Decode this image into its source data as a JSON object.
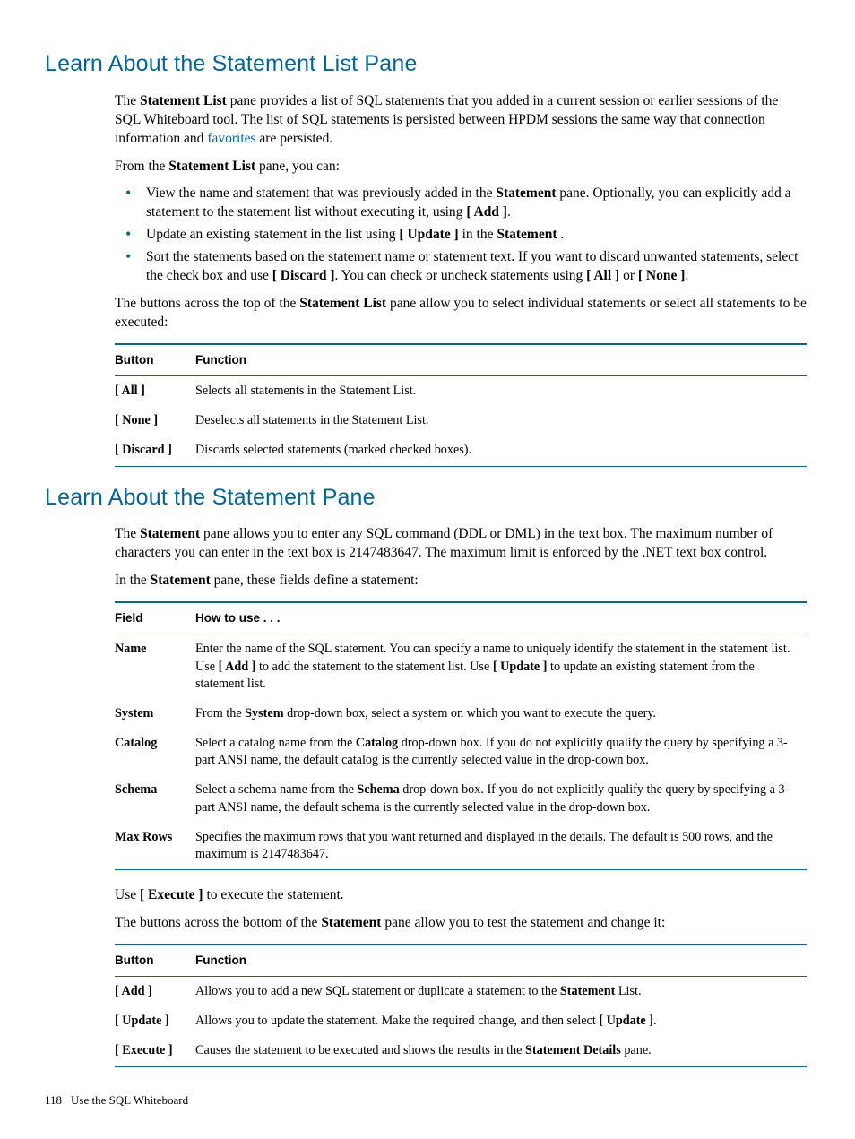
{
  "section1": {
    "heading": "Learn About the Statement List Pane",
    "p1": {
      "t1": "The ",
      "b1": "Statement List",
      "t2": " pane provides a list of SQL statements that you added in a current session or earlier sessions of the SQL Whiteboard tool. The list of SQL statements is persisted between HPDM sessions the same way that connection information and ",
      "link1": "favorites",
      "t3": " are persisted."
    },
    "p2": {
      "t1": "From the ",
      "b1": "Statement List",
      "t2": " pane, you can:"
    },
    "bullets": {
      "b1": {
        "t1": "View the name and statement that was previously added in the ",
        "s1": "Statement",
        "t2": " pane. Optionally, you can explicitly add a statement to the statement list without executing it, using ",
        "s2": "[ Add ]",
        "t3": "."
      },
      "b2": {
        "t1": "Update an existing statement in the list using ",
        "s1": "[ Update ]",
        "t2": " in the ",
        "s2": "Statement",
        "t3": " ."
      },
      "b3": {
        "t1": "Sort the statements based on the statement name or statement text. If you want to discard unwanted statements, select the check box and use ",
        "s1": "[ Discard ]",
        "t2": ". You can check or uncheck statements using ",
        "s2": "[ All ]",
        "t3": " or ",
        "s3": "[ None ]",
        "t4": "."
      }
    },
    "p3": {
      "t1": "The buttons across the top of the ",
      "b1": "Statement List",
      "t2": " pane allow you to select individual statements or select all statements to be executed:"
    },
    "table1": {
      "h1": "Button",
      "h2": "Function",
      "r1": {
        "c1": "[ All ]",
        "c2": "Selects all statements in the Statement List."
      },
      "r2": {
        "c1": "[ None ]",
        "c2": "Deselects all statements in the Statement List."
      },
      "r3": {
        "c1": "[ Discard ]",
        "c2": "Discards selected statements (marked checked boxes)."
      }
    }
  },
  "section2": {
    "heading": "Learn About the Statement Pane",
    "p1": {
      "t1": "The ",
      "b1": "Statement",
      "t2": " pane allows you to enter any SQL command (DDL or DML) in the text box. The maximum number of characters you can enter in the text box is 2147483647. The maximum limit is enforced by the .NET text box control."
    },
    "p2": {
      "t1": "In the ",
      "b1": "Statement",
      "t2": " pane, these fields define a statement:"
    },
    "table2": {
      "h1": "Field",
      "h2": "How to use . . .",
      "r1": {
        "c1": "Name",
        "t1": "Enter the name of the SQL statement. You can specify a name to uniquely identify the statement in the statement list. Use ",
        "s1": "[ Add ]",
        "t2": " to add the statement to the statement list. Use ",
        "s2": "[ Update ]",
        "t3": " to update an existing statement from the statement list."
      },
      "r2": {
        "c1": "System",
        "t1": "From the ",
        "s1": "System",
        "t2": " drop-down box, select a system on which you want to execute the query."
      },
      "r3": {
        "c1": "Catalog",
        "t1": "Select a catalog name from the ",
        "s1": "Catalog",
        "t2": " drop-down box. If you do not explicitly qualify the query by specifying a 3-part ANSI name, the default catalog is the currently selected value in the drop-down box."
      },
      "r4": {
        "c1": "Schema",
        "t1": "Select a schema name from the ",
        "s1": "Schema",
        "t2": " drop-down box. If you do not explicitly qualify the query by specifying a 3-part ANSI name, the default schema is the currently selected value in the drop-down box."
      },
      "r5": {
        "c1": "Max Rows",
        "t1": "Specifies the maximum rows that you want returned and displayed in the details. The default is 500 rows, and the maximum is 2147483647."
      }
    },
    "p3": {
      "t1": "Use ",
      "b1": "[ Execute ]",
      "t2": " to execute the statement."
    },
    "p4": {
      "t1": "The buttons across the bottom of the ",
      "b1": "Statement",
      "t2": " pane allow you to test the statement and change it:"
    },
    "table3": {
      "h1": "Button",
      "h2": "Function",
      "r1": {
        "c1": "[ Add ]",
        "t1": "Allows you to add a new SQL statement or duplicate a statement to the ",
        "s1": "Statement",
        "t2": " List."
      },
      "r2": {
        "c1": "[ Update ]",
        "t1": "Allows you to update the statement. Make the required change, and then select ",
        "s1": "[ Update ]",
        "t2": "."
      },
      "r3": {
        "c1": "[ Execute ]",
        "t1": "Causes the statement to be executed and shows the results in the ",
        "s1": "Statement Details",
        "t2": " pane."
      }
    }
  },
  "footer": {
    "page": "118",
    "title": "Use the SQL Whiteboard"
  }
}
